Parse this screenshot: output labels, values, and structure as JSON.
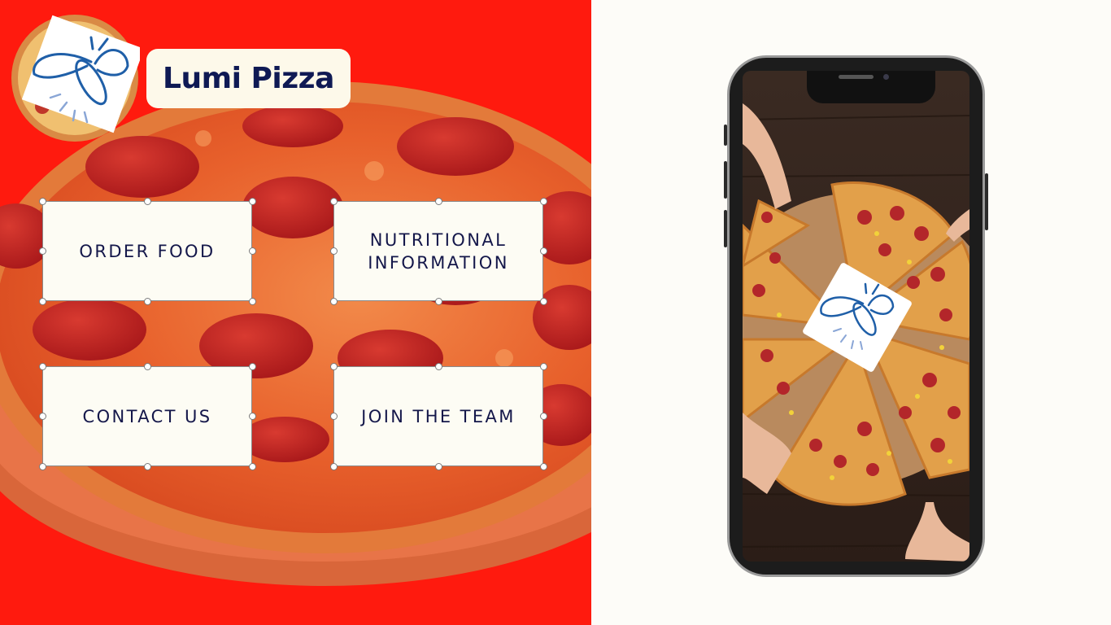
{
  "brand": {
    "name": "Lumi Pizza",
    "logo_icon": "firefly-icon",
    "text_color": "#0f1a54"
  },
  "menu": {
    "order_food": "ORDER FOOD",
    "nutritional_info": "NUTRITIONAL\nINFORMATION",
    "contact_us": "CONTACT US",
    "join_team": "JOIN THE TEAM"
  },
  "colors": {
    "accent_red": "#ff1a0e",
    "card_bg": "#fdfcf4",
    "page_bg": "#fdfcf8",
    "navy": "#14174a"
  },
  "phone": {
    "screen_icon": "firefly-icon",
    "image_subject": "pepperoni-pizza-photo"
  }
}
